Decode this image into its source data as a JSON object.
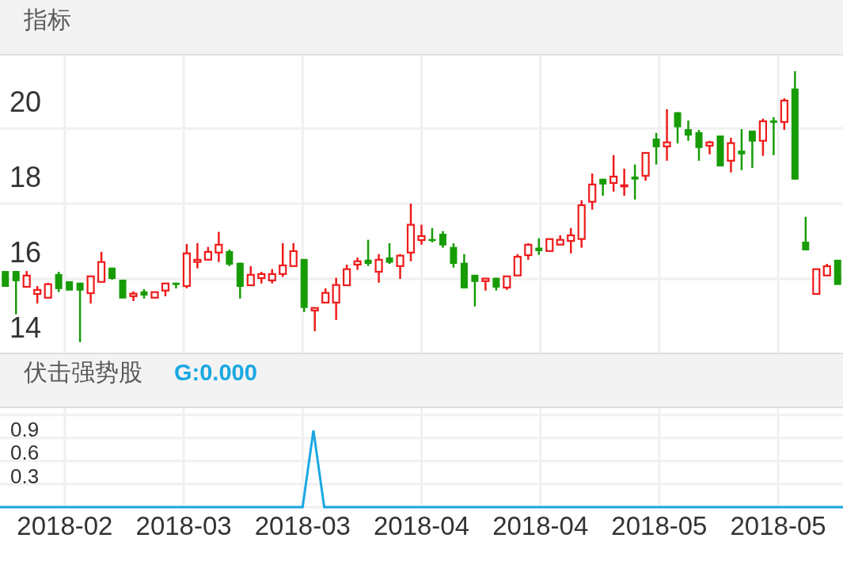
{
  "indicator_bar": {
    "label": "指标"
  },
  "price_chart": {
    "chart_data": {
      "type": "candlestick",
      "ylim": [
        14,
        21.98
      ],
      "yticks": [
        {
          "value": 14,
          "label": "14"
        },
        {
          "value": 16,
          "label": "16"
        },
        {
          "value": 18,
          "label": "18"
        },
        {
          "value": 20,
          "label": "20"
        }
      ],
      "grid": true,
      "categories": [
        null,
        null,
        null,
        null,
        null,
        null,
        null,
        null,
        null,
        null,
        null,
        null,
        null,
        null,
        null,
        null,
        null,
        null,
        null,
        null,
        null,
        null,
        null,
        null,
        null,
        null,
        null,
        null,
        null,
        null,
        null,
        null,
        null,
        null,
        null,
        null,
        null,
        null,
        null,
        null,
        null,
        null,
        null,
        null,
        null,
        null,
        null,
        null,
        null,
        null,
        null,
        null,
        null,
        null,
        null,
        null,
        null,
        null,
        null,
        null,
        null,
        null,
        null,
        null,
        null,
        null,
        null,
        null,
        null,
        null,
        null,
        null,
        null,
        null,
        null,
        null,
        null,
        null,
        null
      ],
      "ohlc": [
        [
          16.21,
          16.21,
          15.79,
          15.79
        ],
        [
          16.21,
          16.21,
          15.06,
          15.94
        ],
        [
          15.77,
          16.21,
          15.77,
          16.11
        ],
        [
          15.58,
          15.81,
          15.35,
          15.73
        ],
        [
          15.48,
          15.9,
          15.48,
          15.88
        ],
        [
          16.13,
          16.19,
          15.65,
          15.73
        ],
        [
          15.94,
          15.94,
          15.69,
          15.69
        ],
        [
          15.9,
          15.9,
          14.32,
          15.69
        ],
        [
          15.6,
          16.09,
          15.35,
          16.09
        ],
        [
          15.9,
          16.72,
          15.9,
          16.47
        ],
        [
          16.3,
          16.3,
          15.98,
          16.0
        ],
        [
          15.98,
          15.98,
          15.48,
          15.48
        ],
        [
          15.52,
          15.67,
          15.41,
          15.63
        ],
        [
          15.67,
          15.73,
          15.48,
          15.56
        ],
        [
          15.48,
          15.67,
          15.48,
          15.67
        ],
        [
          15.67,
          15.9,
          15.54,
          15.9
        ],
        [
          15.9,
          15.9,
          15.75,
          15.84
        ],
        [
          15.79,
          16.93,
          15.75,
          16.7
        ],
        [
          16.43,
          16.95,
          16.28,
          16.53
        ],
        [
          16.49,
          16.85,
          16.49,
          16.74
        ],
        [
          16.68,
          17.25,
          16.45,
          16.93
        ],
        [
          16.74,
          16.78,
          16.34,
          16.38
        ],
        [
          16.43,
          16.43,
          15.48,
          15.79
        ],
        [
          15.81,
          16.34,
          15.81,
          16.13
        ],
        [
          16.0,
          16.19,
          15.88,
          16.15
        ],
        [
          15.94,
          16.26,
          15.88,
          16.15
        ],
        [
          16.11,
          16.95,
          16.05,
          16.38
        ],
        [
          16.32,
          16.95,
          16.32,
          16.76
        ],
        [
          16.53,
          16.53,
          15.12,
          15.23
        ],
        [
          15.14,
          15.25,
          14.61,
          15.25
        ],
        [
          15.35,
          15.75,
          15.35,
          15.65
        ],
        [
          15.35,
          16.03,
          14.91,
          15.86
        ],
        [
          15.81,
          16.38,
          15.81,
          16.28
        ],
        [
          16.36,
          16.57,
          16.24,
          16.49
        ],
        [
          16.51,
          17.04,
          16.34,
          16.4
        ],
        [
          16.17,
          16.66,
          15.9,
          16.53
        ],
        [
          16.57,
          16.95,
          16.4,
          16.43
        ],
        [
          16.32,
          16.66,
          16.0,
          16.64
        ],
        [
          16.68,
          18.0,
          16.47,
          17.46
        ],
        [
          17.01,
          17.44,
          16.91,
          17.16
        ],
        [
          17.06,
          17.35,
          16.97,
          17.01
        ],
        [
          17.2,
          17.27,
          16.83,
          16.89
        ],
        [
          16.85,
          16.95,
          16.3,
          16.4
        ],
        [
          16.43,
          16.66,
          15.75,
          15.75
        ],
        [
          16.11,
          16.11,
          15.27,
          15.92
        ],
        [
          15.92,
          16.03,
          15.69,
          16.03
        ],
        [
          16.03,
          16.03,
          15.69,
          15.77
        ],
        [
          15.75,
          16.09,
          15.71,
          16.09
        ],
        [
          16.07,
          16.66,
          16.07,
          16.61
        ],
        [
          16.61,
          16.95,
          16.51,
          16.93
        ],
        [
          16.83,
          17.08,
          16.64,
          16.74
        ],
        [
          16.72,
          17.08,
          16.72,
          17.08
        ],
        [
          16.89,
          17.16,
          16.89,
          17.06
        ],
        [
          16.99,
          17.35,
          16.68,
          17.18
        ],
        [
          17.04,
          18.09,
          16.83,
          17.98
        ],
        [
          18.03,
          18.8,
          17.84,
          18.53
        ],
        [
          18.66,
          18.66,
          18.21,
          18.51
        ],
        [
          18.53,
          19.29,
          18.32,
          18.74
        ],
        [
          18.45,
          18.93,
          18.21,
          18.51
        ],
        [
          18.72,
          19.04,
          18.11,
          18.64
        ],
        [
          18.72,
          19.37,
          18.61,
          19.37
        ],
        [
          19.73,
          19.88,
          19.04,
          19.5
        ],
        [
          19.5,
          20.51,
          19.14,
          19.65
        ],
        [
          20.43,
          20.43,
          19.6,
          20.03
        ],
        [
          19.98,
          20.21,
          19.67,
          19.81
        ],
        [
          19.9,
          19.96,
          19.14,
          19.48
        ],
        [
          19.52,
          19.67,
          19.31,
          19.65
        ],
        [
          19.81,
          19.81,
          18.99,
          18.99
        ],
        [
          19.12,
          19.75,
          18.83,
          19.63
        ],
        [
          19.41,
          19.98,
          18.89,
          19.31
        ],
        [
          19.94,
          19.94,
          18.95,
          19.65
        ],
        [
          19.65,
          20.26,
          19.27,
          20.21
        ],
        [
          20.21,
          20.3,
          19.29,
          20.15
        ],
        [
          20.15,
          20.8,
          19.96,
          20.76
        ],
        [
          21.06,
          21.52,
          18.64,
          18.64
        ],
        [
          16.99,
          17.65,
          16.76,
          16.76
        ],
        [
          15.58,
          16.28,
          15.58,
          16.28
        ],
        [
          16.07,
          16.4,
          16.07,
          16.36
        ],
        [
          16.51,
          16.51,
          15.84,
          15.84
        ]
      ]
    }
  },
  "indicator_panel": {
    "title": "伏击强势股",
    "reading": "G:0.000",
    "chart_data": {
      "type": "line",
      "ylim": [
        0,
        1.31
      ],
      "yticks": [
        {
          "value": 0.3,
          "label": "0.3"
        },
        {
          "value": 0.6,
          "label": "0.6"
        },
        {
          "value": 0.9,
          "label": "0.9"
        }
      ],
      "grid": true,
      "series": [
        {
          "color": "#19a8e2",
          "values": [
            0,
            0,
            0,
            0,
            0,
            0,
            0,
            0,
            0,
            0,
            0,
            0,
            0,
            0,
            0,
            0,
            0,
            0,
            0,
            0,
            0,
            0,
            0,
            0,
            0,
            0,
            0,
            0,
            0,
            1,
            0,
            0,
            0,
            0,
            0,
            0,
            0,
            0,
            0,
            0,
            0,
            0,
            0,
            0,
            0,
            0,
            0,
            0,
            0,
            0,
            0,
            0,
            0,
            0,
            0,
            0,
            0,
            0,
            0,
            0,
            0,
            0,
            0,
            0,
            0,
            0,
            0,
            0,
            0,
            0,
            0,
            0,
            0,
            0,
            0,
            0,
            0,
            0,
            0
          ]
        }
      ]
    },
    "x_labels": [
      "2018-02",
      "2018-03",
      "2018-03",
      "2018-04",
      "2018-04",
      "2018-05",
      "2018-05"
    ]
  }
}
